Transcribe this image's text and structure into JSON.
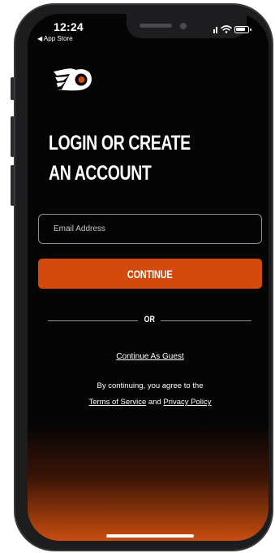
{
  "status_bar": {
    "time": "12:24",
    "back_app": "◀ App Store"
  },
  "brand": {
    "logo_icon": "flyers-logo-icon",
    "accent_color": "#d24a0e"
  },
  "login": {
    "headline_line1": "LOGIN OR CREATE",
    "headline_line2": "AN ACCOUNT",
    "email_placeholder": "Email Address",
    "continue_label": "CONTINUE",
    "divider_label": "OR",
    "guest_label": "Continue As Guest",
    "terms_prefix": "By continuing, you agree to the",
    "terms_link": "Terms of Service",
    "terms_and": "and",
    "privacy_link": "Privacy Policy"
  }
}
